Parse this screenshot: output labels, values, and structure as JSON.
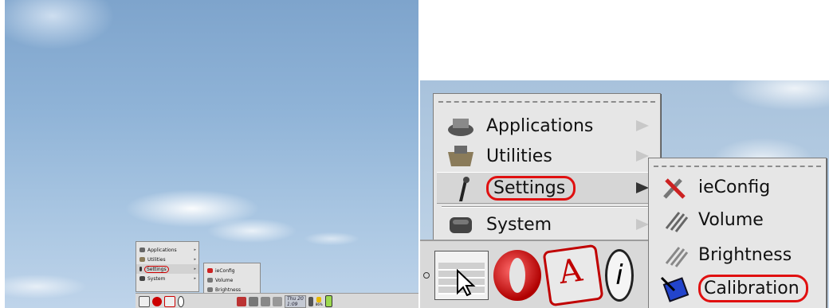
{
  "menu": {
    "items": [
      {
        "label": "Applications",
        "icon": "applications-icon"
      },
      {
        "label": "Utilities",
        "icon": "utilities-icon"
      },
      {
        "label": "Settings",
        "icon": "settings-icon"
      },
      {
        "label": "System",
        "icon": "system-icon"
      }
    ]
  },
  "submenu": {
    "items": [
      {
        "label": "ieConfig",
        "icon": "ieconfig-icon"
      },
      {
        "label": "Volume",
        "icon": "volume-icon"
      },
      {
        "label": "Brightness",
        "icon": "brightness-icon"
      },
      {
        "label": "Calibration",
        "icon": "calibration-icon"
      }
    ]
  },
  "taskbar": {
    "clock_day": "Thu 20",
    "clock_time": "1:09",
    "battery": "86%"
  },
  "colors": {
    "highlight": "#e01010",
    "menu_bg": "#e6e6e6",
    "taskbar_bg": "#d9d9d9"
  }
}
